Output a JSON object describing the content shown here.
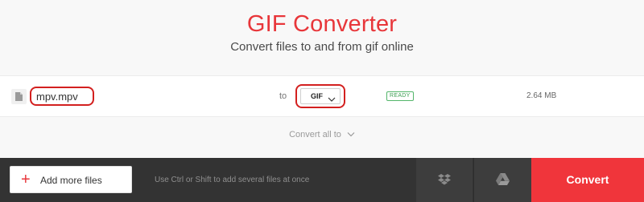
{
  "header": {
    "title": "GIF Converter",
    "subtitle": "Convert files to and from gif online"
  },
  "file": {
    "icon": "file-icon",
    "name": "mpv.mpv",
    "to_label": "to",
    "format": "GIF",
    "status": "READY",
    "size": "2.64 MB"
  },
  "convert_all": {
    "label": "Convert all to"
  },
  "footer": {
    "add_files_label": "Add more files",
    "hint": "Use Ctrl or Shift to add several files at once",
    "dropbox_icon": "dropbox-icon",
    "gdrive_icon": "google-drive-icon",
    "convert_label": "Convert"
  },
  "colors": {
    "accent": "#e8363a",
    "convert_bg": "#f0353b",
    "footer_bg": "#333333",
    "annotation_red": "#d3201f",
    "ready_green": "#53b56a"
  }
}
